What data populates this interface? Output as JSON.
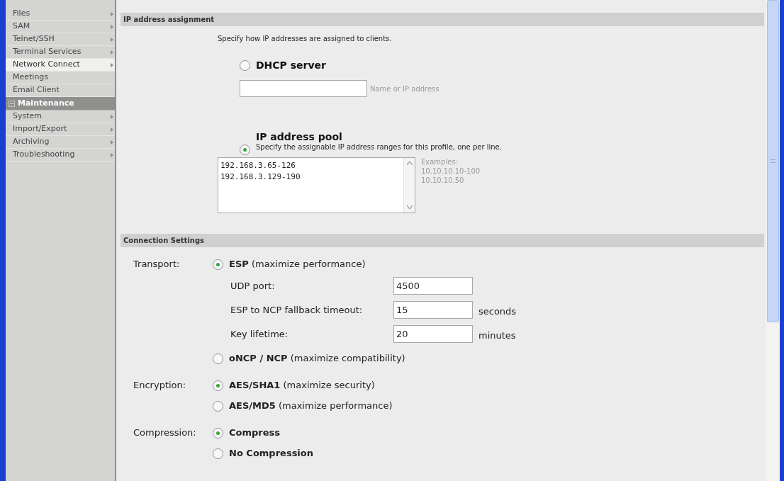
{
  "sidebar": {
    "items": [
      {
        "kind": "item",
        "label": "Files",
        "arrow": true,
        "selected": false
      },
      {
        "kind": "item",
        "label": "SAM",
        "arrow": true,
        "selected": false
      },
      {
        "kind": "item",
        "label": "Telnet/SSH",
        "arrow": true,
        "selected": false
      },
      {
        "kind": "item",
        "label": "Terminal Services",
        "arrow": true,
        "selected": false
      },
      {
        "kind": "item",
        "label": "Network Connect",
        "arrow": true,
        "selected": true
      },
      {
        "kind": "item",
        "label": "Meetings",
        "arrow": false,
        "selected": false
      },
      {
        "kind": "item",
        "label": "Email Client",
        "arrow": false,
        "selected": false
      },
      {
        "kind": "header",
        "label": "Maintenance",
        "expanded": true
      },
      {
        "kind": "item",
        "label": "System",
        "arrow": true,
        "selected": false
      },
      {
        "kind": "item",
        "label": "Import/Export",
        "arrow": true,
        "selected": false
      },
      {
        "kind": "item",
        "label": "Archiving",
        "arrow": true,
        "selected": false
      },
      {
        "kind": "item",
        "label": "Troubleshooting",
        "arrow": true,
        "selected": false
      }
    ]
  },
  "ip_assignment": {
    "title": "IP address assignment",
    "intro": "Specify how IP addresses are assigned to clients.",
    "dhcp": {
      "label": "DHCP server",
      "selected": false,
      "field_hint": "Name or IP address"
    },
    "pool": {
      "label": "IP address pool",
      "selected": true,
      "description": "Specify the assignable IP address ranges for this profile, one per line.",
      "ranges": [
        "192.168.3.65-126",
        "192.168.3.129-190"
      ],
      "examples": [
        "Examples:",
        "10.10.10.10-100",
        "10.10.10.50"
      ]
    }
  },
  "connection_settings": {
    "title": "Connection Settings",
    "groups": [
      {
        "label": "Transport:",
        "options": [
          {
            "name": "ESP",
            "detail": "(maximize performance)",
            "selected": true,
            "fields": [
              {
                "label": "UDP port:",
                "value": "4500"
              },
              {
                "label": "ESP to NCP fallback timeout:",
                "value": "15",
                "unit": "seconds"
              },
              {
                "label": "Key lifetime:",
                "value": "20",
                "unit": "minutes"
              }
            ]
          },
          {
            "name": "oNCP / NCP",
            "detail": "(maximize compatibility)",
            "selected": false
          }
        ]
      },
      {
        "label": "Encryption:",
        "options": [
          {
            "name": "AES/SHA1",
            "detail": "(maximize security)",
            "selected": true
          },
          {
            "name": "AES/MD5",
            "detail": "(maximize performance)",
            "selected": false
          }
        ]
      },
      {
        "label": "Compression:",
        "options": [
          {
            "name": "Compress",
            "selected": true
          },
          {
            "name": "No Compression",
            "selected": false
          }
        ]
      }
    ]
  }
}
